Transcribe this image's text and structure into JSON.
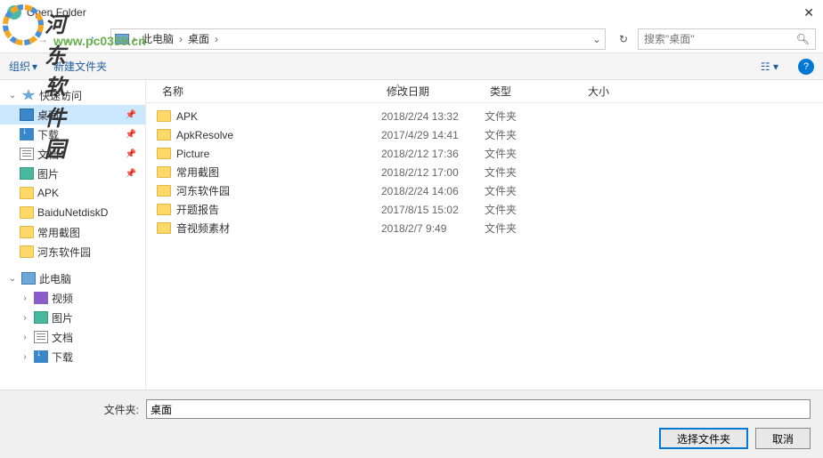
{
  "window": {
    "title": "Open Folder"
  },
  "watermark": {
    "brand": "河东软件园",
    "url": "www.pc0359.cn"
  },
  "nav": {
    "breadcrumb": {
      "item1": "此电脑",
      "item2": "桌面"
    },
    "search_placeholder": "搜索\"桌面\""
  },
  "toolbar": {
    "organize": "组织",
    "new_folder": "新建文件夹"
  },
  "sidebar": {
    "quick_access": "快速访问",
    "desktop": "桌面",
    "downloads": "下载",
    "documents": "文档",
    "pictures": "图片",
    "apk": "APK",
    "baidu": "BaiduNetdiskD",
    "screenshots": "常用截图",
    "hedong": "河东软件园",
    "this_pc": "此电脑",
    "videos": "视频",
    "pictures2": "图片",
    "documents2": "文档",
    "downloads2": "下载"
  },
  "columns": {
    "name": "名称",
    "date": "修改日期",
    "type": "类型",
    "size": "大小"
  },
  "files": [
    {
      "name": "APK",
      "date": "2018/2/24 13:32",
      "type": "文件夹"
    },
    {
      "name": "ApkResolve",
      "date": "2017/4/29 14:41",
      "type": "文件夹"
    },
    {
      "name": "Picture",
      "date": "2018/2/12 17:36",
      "type": "文件夹"
    },
    {
      "name": "常用截图",
      "date": "2018/2/12 17:00",
      "type": "文件夹"
    },
    {
      "name": "河东软件园",
      "date": "2018/2/24 14:06",
      "type": "文件夹"
    },
    {
      "name": "开题报告",
      "date": "2017/8/15 15:02",
      "type": "文件夹"
    },
    {
      "name": "音视频素材",
      "date": "2018/2/7 9:49",
      "type": "文件夹"
    }
  ],
  "footer": {
    "folder_label": "文件夹:",
    "folder_value": "桌面",
    "select_btn": "选择文件夹",
    "cancel_btn": "取消"
  }
}
